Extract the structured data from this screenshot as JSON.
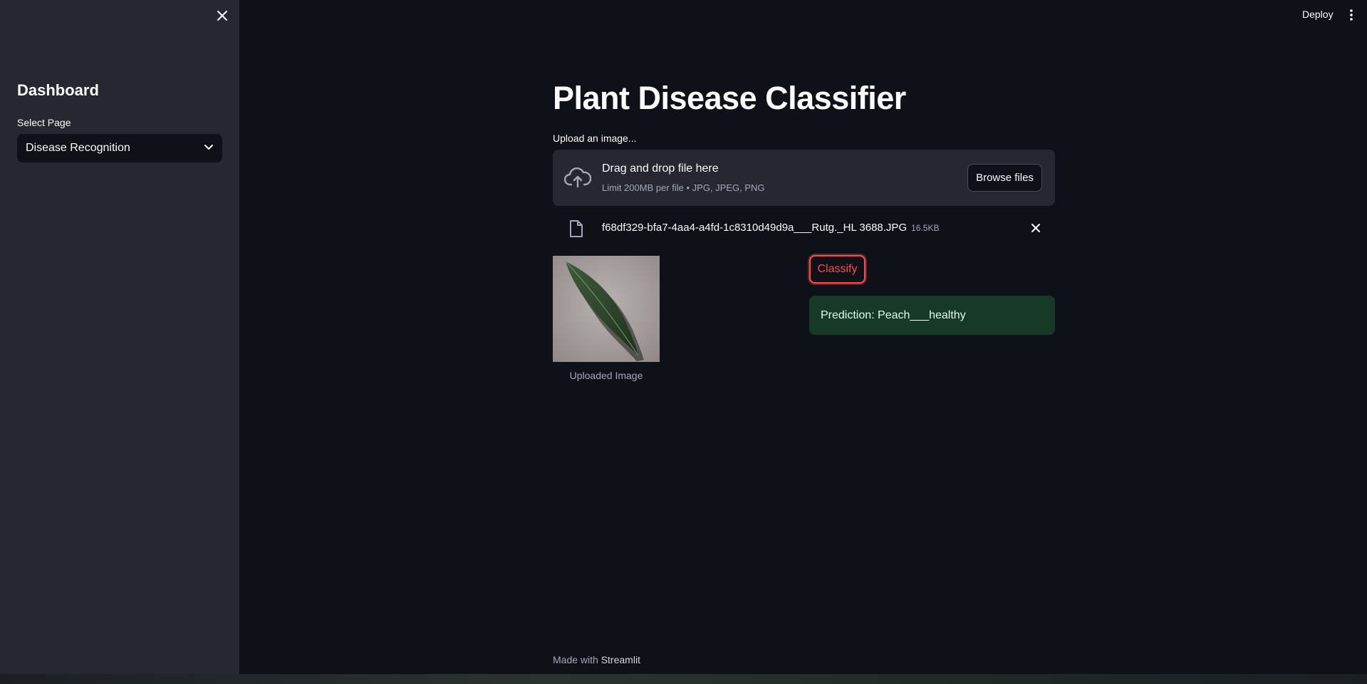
{
  "sidebar": {
    "title": "Dashboard",
    "select_label": "Select Page",
    "select_value": "Disease Recognition"
  },
  "header": {
    "deploy_label": "Deploy"
  },
  "main": {
    "title": "Plant Disease Classifier",
    "upload_label": "Upload an image...",
    "dropzone": {
      "main_text": "Drag and drop file here",
      "sub_text": "Limit 200MB per file • JPG, JPEG, PNG",
      "browse_label": "Browse files"
    },
    "file": {
      "name": "f68df329-bfa7-4aa4-a4fd-1c8310d49d9a___Rutg._HL 3688.JPG",
      "size": "16.5KB"
    },
    "image_caption": "Uploaded Image",
    "classify_label": "Classify",
    "prediction": "Prediction: Peach___healthy"
  },
  "footer": {
    "prefix": "Made with",
    "brand": "Streamlit"
  },
  "colors": {
    "background": "#0e1117",
    "sidebar": "#262730",
    "accent": "#ff4b4b",
    "success_bg": "#173928",
    "success_text": "#dffde9"
  }
}
